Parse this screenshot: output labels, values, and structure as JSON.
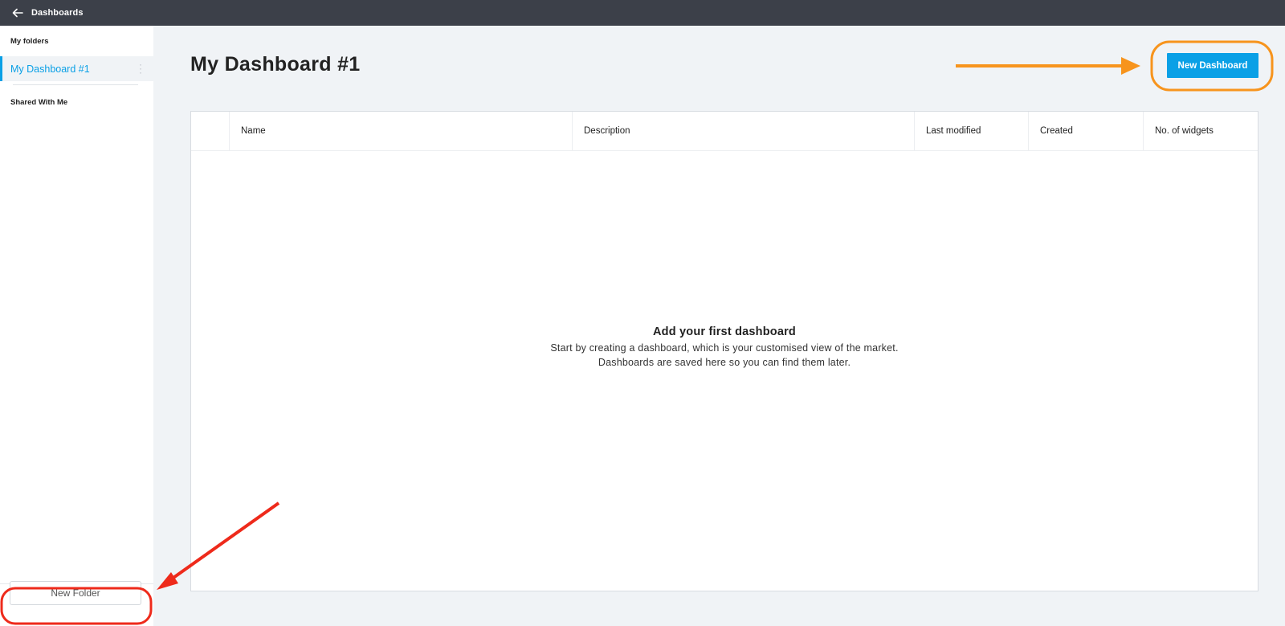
{
  "topbar": {
    "back_icon": "arrow-left-icon",
    "title": "Dashboards"
  },
  "sidebar": {
    "my_folders_label": "My folders",
    "folders": [
      {
        "label": "My Dashboard #1",
        "selected": true
      }
    ],
    "shared_label": "Shared With Me",
    "new_folder_label": "New Folder"
  },
  "main": {
    "title": "My Dashboard #1",
    "new_dashboard_label": "New Dashboard",
    "table": {
      "columns": [
        "",
        "Name",
        "Description",
        "Last modified",
        "Created",
        "No. of widgets"
      ]
    },
    "empty_state": {
      "heading": "Add your first dashboard",
      "line1": "Start by creating a dashboard, which is your customised view of the market.",
      "line2": "Dashboards are saved here so you can find them later."
    }
  },
  "colors": {
    "accent": "#0aa0e6",
    "topbar": "#3c4049",
    "annotation_orange": "#f7941d",
    "annotation_red": "#ee2a1b"
  }
}
